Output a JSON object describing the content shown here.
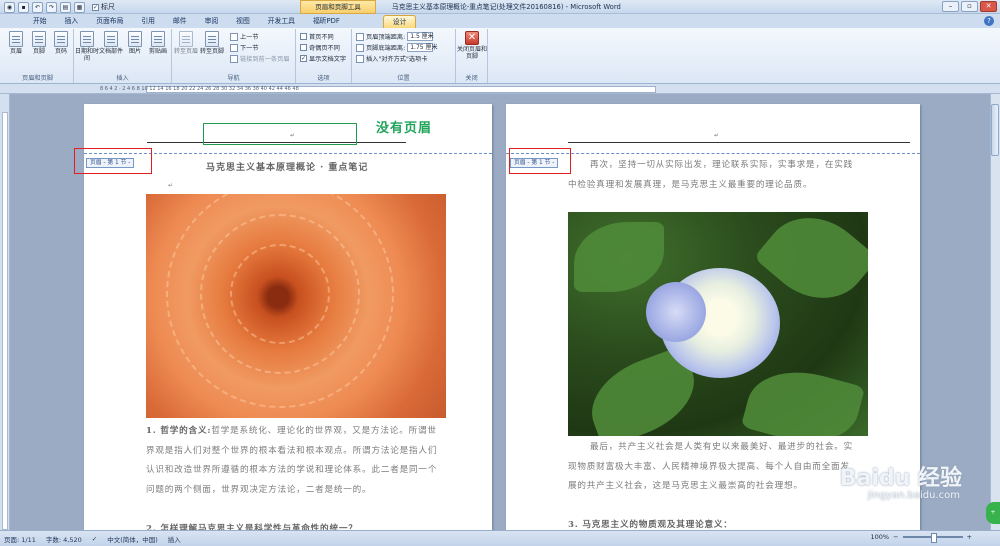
{
  "titlebar": {
    "ruler_label": "标尺",
    "context_tool": "页眉和页脚工具",
    "doc_title": "马克思主义基本原理概论-重点笔记(处理文件20160816) - Microsoft Word"
  },
  "tabs": [
    "开始",
    "插入",
    "页面布局",
    "引用",
    "邮件",
    "审阅",
    "视图",
    "开发工具",
    "福昕PDF",
    "设计"
  ],
  "ribbon": {
    "group_header_footer": {
      "label": "页眉和页脚",
      "buttons": [
        "页眉",
        "页脚",
        "页码"
      ]
    },
    "group_insert": {
      "label": "插入",
      "buttons": [
        "日期和时间",
        "文档部件",
        "图片",
        "剪贴画"
      ]
    },
    "group_nav": {
      "label": "导航",
      "buttons": [
        "转至页眉",
        "转至页脚"
      ],
      "prev": "上一节",
      "next": "下一节",
      "link": "链接到前一条页眉"
    },
    "group_options": {
      "label": "选项",
      "items": [
        "首页不同",
        "奇偶页不同",
        "显示文档文字"
      ]
    },
    "group_position": {
      "label": "位置",
      "header_dist_label": "页眉顶端距离:",
      "header_dist": "1.5 厘米",
      "footer_dist_label": "页脚底端距离:",
      "footer_dist": "1.75 厘米",
      "insert_align": "插入\"对齐方式\"选项卡"
    },
    "group_close": {
      "label": "关闭",
      "button": "关闭页眉和页脚"
    }
  },
  "ruler": {
    "ticks": "8   6   4   2   ·   2   4   6   8  10  12  14  16  18  20  22  24  26  28  30  32  34  36  38  40  42  44  46  48"
  },
  "page1": {
    "header_tag": "页眉 - 第 1 节 -",
    "heading": "马克思主义基本原理概论 · 重点笔记",
    "para1_label": "1. 哲学的含义:",
    "para1": "哲学是系统化、理论化的世界观，又是方法论。所谓世界观是指人们对整个世界的根本看法和根本观点。所谓方法论是指人们认识和改造世界所遵循的根本方法的学说和理论体系。此二者是同一个问题的两个侧面，世界观决定方法论，二者是统一的。",
    "para2": "2. 怎样理解马克思主义是科学性与革命性的统一？"
  },
  "page2": {
    "header_tag": "页眉 - 第 1 节 -",
    "para1": "再次，坚持一切从实际出发，理论联系实际，实事求是，在实践中检验真理和发展真理，是马克思主义最重要的理论品质。",
    "para2": "最后，共产主义社会是人类有史以来最美好、最进步的社会。实现物质财富极大丰富、人民精神境界极大提高、每个人自由而全面发展的共产主义社会，这是马克思主义最崇高的社会理想。",
    "para3": "3. 马克思主义的物质观及其理论意义："
  },
  "annotation": {
    "text": "没有页眉"
  },
  "watermark": {
    "text": "Baidu 经验",
    "sub": "jingyan.baidu.com"
  },
  "statusbar": {
    "page": "页面: 1/11",
    "words": "字数: 4,520",
    "lang": "中文(简体，中国)",
    "mode": "插入",
    "zoom": "100%"
  },
  "colors": {
    "annotation": "#1fa45a",
    "highlight_box": "#e21d1d",
    "header_separator": "#6c8fc6"
  }
}
